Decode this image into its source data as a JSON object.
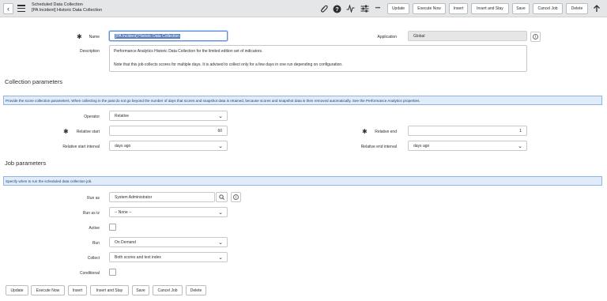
{
  "header": {
    "title": "Scheduled Data Collection",
    "subtitle": "[PA Incident] Historic Data Collection",
    "icons": [
      "paperclip-icon",
      "help-icon",
      "activity-icon",
      "settings-sliders-icon",
      "more-icon",
      "arrow-up-icon"
    ],
    "more_label": "•••",
    "buttons": {
      "update": "Update",
      "execute_now": "Execute Now",
      "insert": "Insert",
      "insert_and_stay": "Insert and Stay",
      "save": "Save",
      "cancel_job": "Cancel Job",
      "delete": "Delete"
    }
  },
  "form": {
    "name_label": "Name",
    "name_value": "[PA Incident] Historic Data Collection",
    "application_label": "Application",
    "application_value": "Global",
    "description_label": "Description",
    "description_line1": "Performance Analytics Historic Data Collection for the limited edition set of indicators.",
    "description_line2": "Note that this job collects scores for multiple days. It is advised to collect only for a few days in one run depending on configuration."
  },
  "collection": {
    "title": "Collection parameters",
    "info": "Provide the score collection parameters. When collecting in the past do not go beyond the number of days that scores and snapshot data is retained, because scores and snapshot data is then removed automatically. See the Performance Analytics properties.",
    "operator_label": "Operator",
    "operator_value": "Relative",
    "relative_start_label": "Relative start",
    "relative_start_value": "60",
    "relative_end_label": "Relative end",
    "relative_end_value": "1",
    "relative_start_interval_label": "Relative start interval",
    "relative_start_interval_value": "days ago",
    "relative_end_interval_label": "Relative end interval",
    "relative_end_interval_value": "days ago"
  },
  "job": {
    "title": "Job parameters",
    "info": "Specify when to run the scheduled data collection job.",
    "run_as_label": "Run as",
    "run_as_value": "System Administrator",
    "run_as_tz_label": "Run as tz",
    "run_as_tz_value": "-- None --",
    "active_label": "Active",
    "active_checked": false,
    "run_label": "Run",
    "run_value": "On Demand",
    "collect_label": "Collect",
    "collect_value": "Both scores and text index",
    "conditional_label": "Conditional",
    "conditional_checked": false
  },
  "footer": {
    "update": "Update",
    "execute_now": "Execute Now",
    "insert": "Insert",
    "insert_and_stay": "Insert and Stay",
    "save": "Save",
    "cancel_job": "Cancel Job",
    "delete": "Delete"
  },
  "glyphs": {
    "required": "✱",
    "chevron": "⌄",
    "back": "‹",
    "info": "i"
  }
}
